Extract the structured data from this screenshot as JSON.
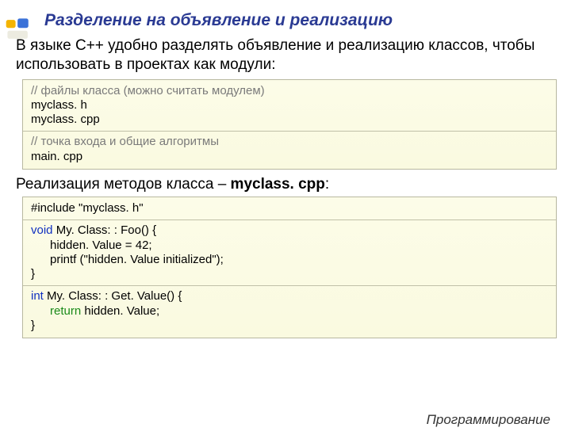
{
  "title": "Разделение на объявление и реализацию",
  "intro": "В языке C++ удобно разделять объявление и реализацию классов, чтобы использовать в проектах как модули:",
  "box1": {
    "comment1": "// файлы класса (можно считать модулем)",
    "l1": "myclass. h",
    "l2": "myclass. cpp",
    "comment2": "// точка входа и общие алгоритмы",
    "l3": "main. cpp"
  },
  "subhead_plain": "Реализация методов класса – ",
  "subhead_bold": "myclass. cpp",
  "subhead_tail": ":",
  "box2": {
    "include": "#include \"myclass. h\"",
    "sig1_kw": "void",
    "sig1_rest": " My. Class: : Foo() {",
    "body1a": "hidden. Value = 42;",
    "body1b": "printf (\"hidden. Value initialized\");",
    "close1": "}",
    "sig2_kw": "int",
    "sig2_rest": " My. Class: : Get. Value() {",
    "ret_kw": "return",
    "ret_rest": " hidden. Value;",
    "close2": "}"
  },
  "footer": "Программирование"
}
